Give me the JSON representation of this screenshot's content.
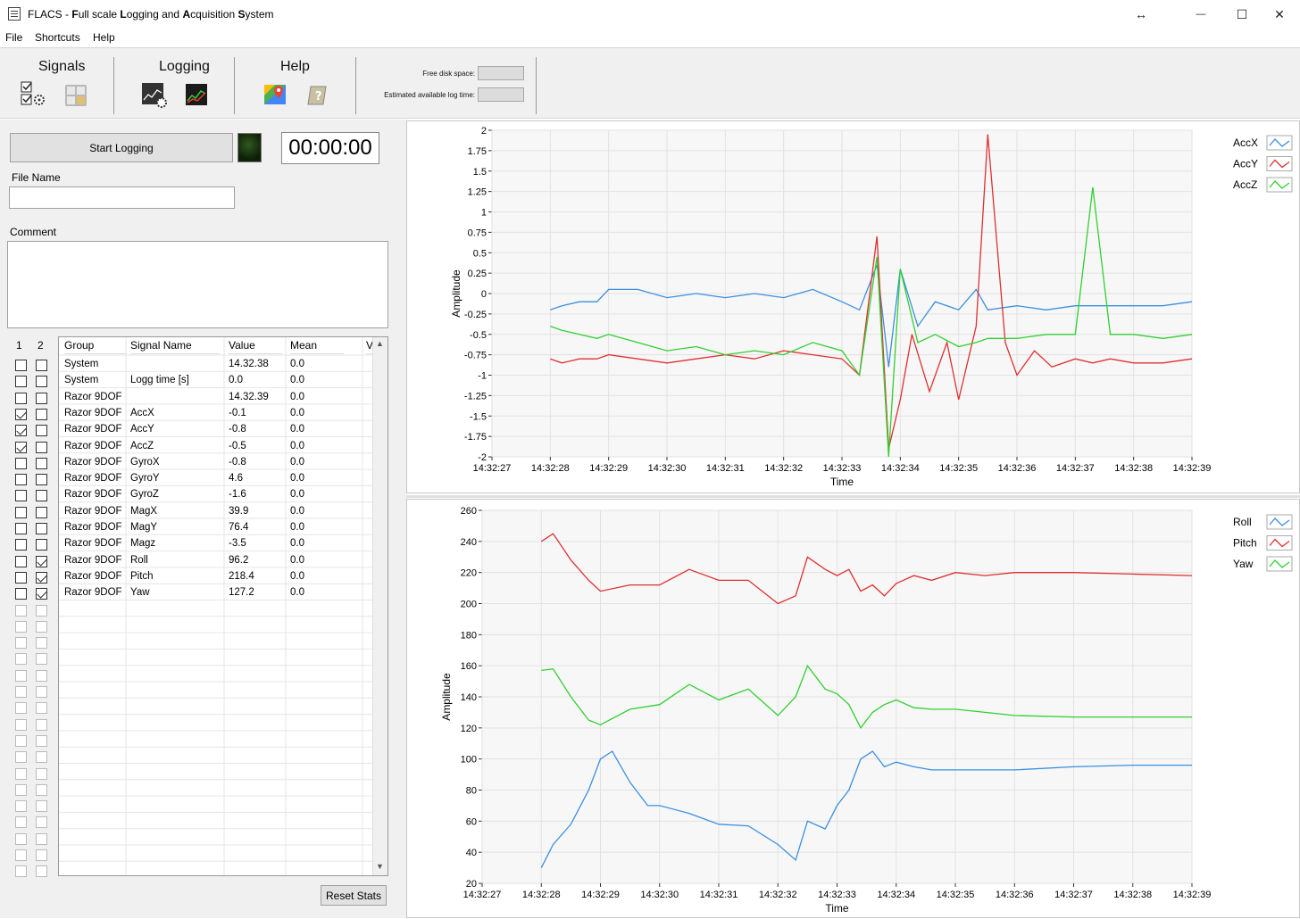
{
  "window": {
    "title_prefix": "FLACS - ",
    "title_bold1": "F",
    "title_t1": "ull scale ",
    "title_bold2": "L",
    "title_t2": "ogging and ",
    "title_bold3": "A",
    "title_t3": "cquisition ",
    "title_bold4": "S",
    "title_t4": "ystem",
    "resize_glyph": "↔",
    "min_glyph": "—",
    "max_glyph": "☐",
    "close_glyph": "✕"
  },
  "menu": [
    "File",
    "Shortcuts",
    "Help"
  ],
  "toolbar": {
    "signals": "Signals",
    "logging": "Logging",
    "help": "Help",
    "free_disk": "Free disk space:",
    "est_log": "Estimated available log time:"
  },
  "logging": {
    "start_label": "Start Logging",
    "timer": "00:00:00",
    "file_name_label": "File Name",
    "file_name_value": "",
    "comment_label": "Comment",
    "comment_value": ""
  },
  "table": {
    "cols": [
      "1",
      "2",
      "Group",
      "Signal Name",
      "Value",
      "Mean",
      "V"
    ],
    "rows": [
      {
        "c1": false,
        "c2": false,
        "group": "System",
        "signal": "",
        "value": "14.32.38",
        "mean": "0.0"
      },
      {
        "c1": false,
        "c2": false,
        "group": "System",
        "signal": "Logg time [s]",
        "value": "0.0",
        "mean": "0.0"
      },
      {
        "c1": false,
        "c2": false,
        "group": "Razor 9DOF",
        "signal": "",
        "value": "14.32.39",
        "mean": "0.0"
      },
      {
        "c1": true,
        "c2": false,
        "group": "Razor 9DOF",
        "signal": "AccX",
        "value": "-0.1",
        "mean": "0.0"
      },
      {
        "c1": true,
        "c2": false,
        "group": "Razor 9DOF",
        "signal": "AccY",
        "value": "-0.8",
        "mean": "0.0"
      },
      {
        "c1": true,
        "c2": false,
        "group": "Razor 9DOF",
        "signal": "AccZ",
        "value": "-0.5",
        "mean": "0.0"
      },
      {
        "c1": false,
        "c2": false,
        "group": "Razor 9DOF",
        "signal": "GyroX",
        "value": "-0.8",
        "mean": "0.0"
      },
      {
        "c1": false,
        "c2": false,
        "group": "Razor 9DOF",
        "signal": "GyroY",
        "value": "4.6",
        "mean": "0.0"
      },
      {
        "c1": false,
        "c2": false,
        "group": "Razor 9DOF",
        "signal": "GyroZ",
        "value": "-1.6",
        "mean": "0.0"
      },
      {
        "c1": false,
        "c2": false,
        "group": "Razor 9DOF",
        "signal": "MagX",
        "value": "39.9",
        "mean": "0.0"
      },
      {
        "c1": false,
        "c2": false,
        "group": "Razor 9DOF",
        "signal": "MagY",
        "value": "76.4",
        "mean": "0.0"
      },
      {
        "c1": false,
        "c2": false,
        "group": "Razor 9DOF",
        "signal": "Magz",
        "value": "-3.5",
        "mean": "0.0"
      },
      {
        "c1": false,
        "c2": true,
        "group": "Razor 9DOF",
        "signal": "Roll",
        "value": "96.2",
        "mean": "0.0"
      },
      {
        "c1": false,
        "c2": true,
        "group": "Razor 9DOF",
        "signal": "Pitch",
        "value": "218.4",
        "mean": "0.0"
      },
      {
        "c1": false,
        "c2": true,
        "group": "Razor 9DOF",
        "signal": "Yaw",
        "value": "127.2",
        "mean": "0.0"
      }
    ]
  },
  "reset_label": "Reset Stats",
  "chart_data": [
    {
      "type": "line",
      "xlabel": "Time",
      "ylabel": "Amplitude",
      "ylim": [
        -2,
        2
      ],
      "yticks": [
        "2",
        "1.75",
        "1.5",
        "1.25",
        "1",
        "0.75",
        "0.5",
        "0.25",
        "0",
        "-0.25",
        "-0.5",
        "-0.75",
        "-1",
        "-1.25",
        "-1.5",
        "-1.75",
        "-2"
      ],
      "xticks": [
        "14:32:27",
        "14:32:28",
        "14:32:29",
        "14:32:30",
        "14:32:31",
        "14:32:32",
        "14:32:33",
        "14:32:34",
        "14:32:35",
        "14:32:36",
        "14:32:37",
        "14:32:38",
        "14:32:39"
      ],
      "grid": true,
      "legend": "right",
      "series": [
        {
          "name": "AccX",
          "color": "#3b8fe0",
          "x": [
            28.0,
            28.2,
            28.5,
            28.8,
            29.0,
            29.5,
            30.0,
            30.5,
            31.0,
            31.5,
            32.0,
            32.5,
            33.0,
            33.3,
            33.6,
            33.8,
            34.0,
            34.3,
            34.6,
            35.0,
            35.3,
            35.5,
            36.0,
            36.5,
            37.0,
            37.5,
            38.0,
            38.5,
            39.0
          ],
          "y": [
            -0.2,
            -0.15,
            -0.1,
            -0.1,
            0.05,
            0.05,
            -0.05,
            0.0,
            -0.05,
            0.0,
            -0.05,
            0.05,
            -0.1,
            -0.2,
            0.35,
            -0.9,
            0.3,
            -0.4,
            -0.1,
            -0.2,
            0.05,
            -0.2,
            -0.15,
            -0.2,
            -0.15,
            -0.15,
            -0.15,
            -0.15,
            -0.1
          ]
        },
        {
          "name": "AccY",
          "color": "#e03030",
          "x": [
            28.0,
            28.2,
            28.5,
            28.8,
            29.0,
            29.5,
            30.0,
            30.5,
            31.0,
            31.5,
            32.0,
            32.5,
            33.0,
            33.3,
            33.6,
            33.8,
            34.0,
            34.2,
            34.5,
            34.8,
            35.0,
            35.3,
            35.5,
            35.8,
            36.0,
            36.3,
            36.6,
            37.0,
            37.3,
            37.6,
            38.0,
            38.5,
            39.0
          ],
          "y": [
            -0.8,
            -0.85,
            -0.8,
            -0.8,
            -0.75,
            -0.8,
            -0.85,
            -0.8,
            -0.75,
            -0.8,
            -0.7,
            -0.75,
            -0.8,
            -1.0,
            0.7,
            -1.9,
            -1.3,
            -0.5,
            -1.2,
            -0.6,
            -1.3,
            -0.4,
            1.95,
            -0.6,
            -1.0,
            -0.7,
            -0.9,
            -0.8,
            -0.85,
            -0.8,
            -0.85,
            -0.85,
            -0.8
          ]
        },
        {
          "name": "AccZ",
          "color": "#30d030",
          "x": [
            28.0,
            28.2,
            28.5,
            28.8,
            29.0,
            29.5,
            30.0,
            30.5,
            31.0,
            31.5,
            32.0,
            32.5,
            33.0,
            33.3,
            33.6,
            33.8,
            34.0,
            34.3,
            34.6,
            35.0,
            35.3,
            35.5,
            36.0,
            36.5,
            37.0,
            37.3,
            37.6,
            38.0,
            38.5,
            39.0
          ],
          "y": [
            -0.4,
            -0.45,
            -0.5,
            -0.55,
            -0.5,
            -0.6,
            -0.7,
            -0.65,
            -0.75,
            -0.7,
            -0.75,
            -0.6,
            -0.7,
            -1.0,
            0.45,
            -2.0,
            0.3,
            -0.6,
            -0.5,
            -0.65,
            -0.6,
            -0.55,
            -0.55,
            -0.5,
            -0.5,
            1.3,
            -0.5,
            -0.5,
            -0.55,
            -0.5
          ]
        }
      ]
    },
    {
      "type": "line",
      "xlabel": "Time",
      "ylabel": "Amplitude",
      "ylim": [
        20,
        260
      ],
      "yticks": [
        "260",
        "240",
        "220",
        "200",
        "180",
        "160",
        "140",
        "120",
        "100",
        "80",
        "60",
        "40",
        "20"
      ],
      "xticks": [
        "14:32:27",
        "14:32:28",
        "14:32:29",
        "14:32:30",
        "14:32:31",
        "14:32:32",
        "14:32:33",
        "14:32:34",
        "14:32:35",
        "14:32:36",
        "14:32:37",
        "14:32:38",
        "14:32:39"
      ],
      "grid": true,
      "legend": "right",
      "series": [
        {
          "name": "Roll",
          "color": "#3b8fe0",
          "x": [
            28.0,
            28.2,
            28.5,
            28.8,
            29.0,
            29.2,
            29.5,
            29.8,
            30.0,
            30.5,
            31.0,
            31.5,
            32.0,
            32.3,
            32.5,
            32.8,
            33.0,
            33.2,
            33.4,
            33.6,
            33.8,
            34.0,
            34.3,
            34.6,
            35.0,
            36.0,
            37.0,
            38.0,
            39.0
          ],
          "y": [
            30,
            45,
            58,
            80,
            100,
            105,
            85,
            70,
            70,
            65,
            58,
            57,
            45,
            35,
            60,
            55,
            70,
            80,
            100,
            105,
            95,
            98,
            95,
            93,
            93,
            93,
            95,
            96,
            96
          ]
        },
        {
          "name": "Pitch",
          "color": "#e03030",
          "x": [
            28.0,
            28.2,
            28.5,
            28.8,
            29.0,
            29.5,
            30.0,
            30.5,
            31.0,
            31.5,
            32.0,
            32.3,
            32.5,
            32.8,
            33.0,
            33.2,
            33.4,
            33.6,
            33.8,
            34.0,
            34.3,
            34.6,
            35.0,
            35.5,
            36.0,
            37.0,
            38.0,
            39.0
          ],
          "y": [
            240,
            245,
            228,
            215,
            208,
            212,
            212,
            222,
            215,
            215,
            200,
            205,
            230,
            222,
            218,
            222,
            208,
            212,
            205,
            213,
            218,
            215,
            220,
            218,
            220,
            220,
            219,
            218
          ]
        },
        {
          "name": "Yaw",
          "color": "#30d030",
          "x": [
            28.0,
            28.2,
            28.5,
            28.8,
            29.0,
            29.5,
            30.0,
            30.5,
            31.0,
            31.5,
            32.0,
            32.3,
            32.5,
            32.8,
            33.0,
            33.2,
            33.4,
            33.6,
            33.8,
            34.0,
            34.3,
            34.6,
            35.0,
            35.5,
            36.0,
            37.0,
            38.0,
            39.0
          ],
          "y": [
            157,
            158,
            140,
            125,
            122,
            132,
            135,
            148,
            138,
            145,
            128,
            140,
            160,
            145,
            142,
            135,
            120,
            130,
            135,
            138,
            133,
            132,
            132,
            130,
            128,
            127,
            127,
            127
          ]
        }
      ]
    }
  ]
}
